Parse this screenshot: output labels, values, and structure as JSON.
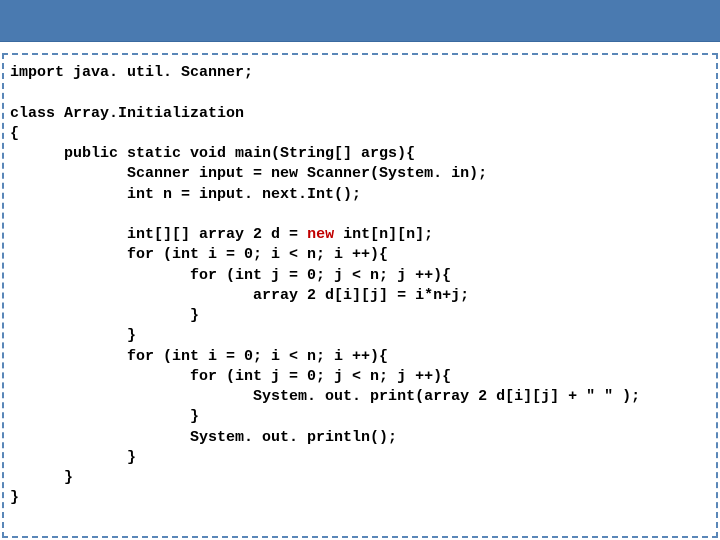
{
  "code": {
    "l01": "import java. util. Scanner;",
    "l02": "",
    "l03": "class Array.Initialization",
    "l04": "{",
    "l05": "      public static void main(String[] args){",
    "l06": "             Scanner input = new Scanner(System. in);",
    "l07": "             int n = input. next.Int();",
    "l08": "",
    "l09a": "             int[][] array 2 d = ",
    "l09b": "new",
    "l09c": " int[n][n];",
    "l10": "             for (int i = 0; i < n; i ++){",
    "l11": "                    for (int j = 0; j < n; j ++){",
    "l12": "                           array 2 d[i][j] = i*n+j;",
    "l13": "                    }",
    "l14": "             }",
    "l15": "             for (int i = 0; i < n; i ++){",
    "l16": "                    for (int j = 0; j < n; j ++){",
    "l17": "                           System. out. print(array 2 d[i][j] + \" \" );",
    "l18": "                    }",
    "l19": "                    System. out. println();",
    "l20": "             }",
    "l21": "      }",
    "l22": "}"
  }
}
